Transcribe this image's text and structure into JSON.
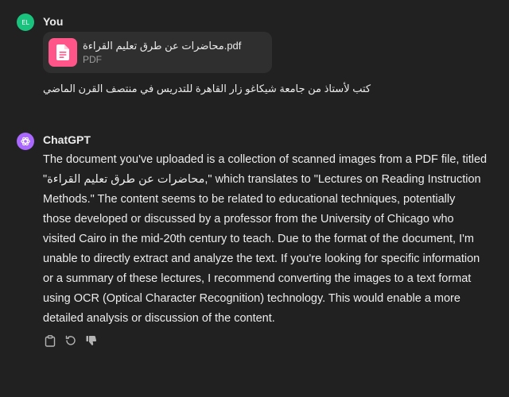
{
  "messages": {
    "user": {
      "avatar_initials": "EL",
      "author": "You",
      "attachment": {
        "name": "محاضرات عن طرق تعليم القراءة.pdf",
        "type": "PDF",
        "icon": "document-icon"
      },
      "text": "كتب لأستاذ من جامعة شيكاغو زار القاهرة للتدريس في منتصف القرن الماضي"
    },
    "assistant": {
      "author": "ChatGPT",
      "lines": [
        "The document you've uploaded is a collection of scanned images from a PDF file, titled",
        "\"محاضرات عن طرق تعليم القراءة,\" which translates to \"Lectures on Reading Instruction",
        "Methods.\" The content seems to be related to educational techniques, potentially",
        "those developed or discussed by a professor from the University of Chicago who",
        "visited Cairo in the mid-20th century to teach. Due to the format of the document, I'm",
        "unable to directly extract and analyze the text. If you're looking for specific information",
        "or a summary of these lectures, I recommend converting the images to a text format",
        "using OCR (Optical Character Recognition) technology. This would enable a more",
        "detailed analysis or discussion of the content."
      ],
      "actions": [
        "copy-icon",
        "regenerate-icon",
        "thumbs-down-icon"
      ]
    }
  },
  "colors": {
    "background": "#212121",
    "user_avatar": "#19c37d",
    "assistant_avatar": "#ab68ff",
    "file_icon_bg": "#ff5588",
    "file_card_bg": "#2f2f2f"
  }
}
